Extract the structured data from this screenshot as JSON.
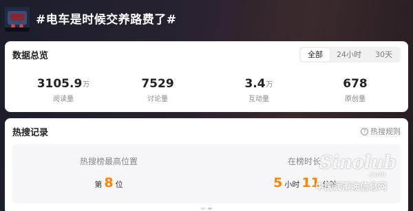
{
  "topic": {
    "title": "#电车是时候交养路费了#"
  },
  "overview": {
    "title": "数据总览",
    "tabs": [
      {
        "label": "全部",
        "active": true
      },
      {
        "label": "24小时",
        "active": false
      },
      {
        "label": "30天",
        "active": false
      }
    ],
    "stats": [
      {
        "value": "3105.9",
        "unit": "万",
        "label": "阅读量"
      },
      {
        "value": "7529",
        "unit": "",
        "label": "讨论量"
      },
      {
        "value": "3.4",
        "unit": "万",
        "label": "互动量"
      },
      {
        "value": "678",
        "unit": "",
        "label": "原创量"
      }
    ]
  },
  "hot_search": {
    "title": "热搜记录",
    "help_label": "热搜规则",
    "best_position": {
      "label": "热搜榜最高位置",
      "prefix": "第",
      "value": "8",
      "suffix": "位"
    },
    "duration": {
      "label": "在榜时长",
      "hours": "5",
      "hours_unit": "小时",
      "minutes": "11",
      "minutes_unit": "分钟"
    }
  },
  "watermark": {
    "logo": "Sinolub",
    "domain": ".com",
    "text": "中国润滑油信息网"
  },
  "colors": {
    "accent": "#ff8200",
    "header_bg": "#1f1e2a"
  }
}
